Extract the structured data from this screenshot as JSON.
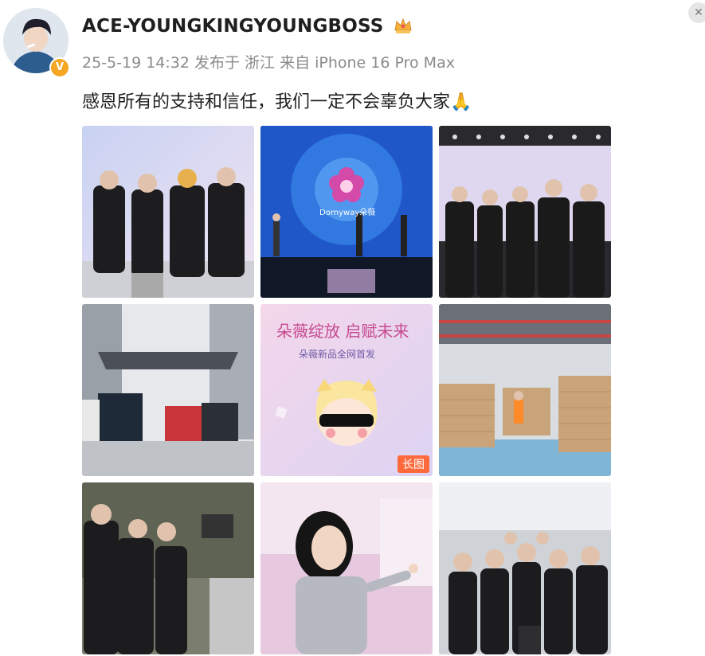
{
  "post": {
    "username": "ACE-YOUNGKINGYOUNGBOSS",
    "verified_badge": "V",
    "meta": "25-5-19 14:32 发布于 浙江 来自 iPhone 16 Pro Max",
    "text": "感恩所有的支持和信任，我们一定不会辜负大家🙏"
  },
  "close_icon": "✕",
  "images": [
    {
      "id": "img-1"
    },
    {
      "id": "img-2",
      "overlay": "Dornyway朵薇"
    },
    {
      "id": "img-3"
    },
    {
      "id": "img-4"
    },
    {
      "id": "img-5",
      "headline": "朵薇绽放 启赋未来",
      "subhead": "朵薇新品全网首发",
      "long_tag": "长图"
    },
    {
      "id": "img-6"
    },
    {
      "id": "img-7"
    },
    {
      "id": "img-8"
    },
    {
      "id": "img-9"
    }
  ],
  "colors": {
    "badge_orange": "#f5a623",
    "long_tag": "#ff6a3d"
  }
}
